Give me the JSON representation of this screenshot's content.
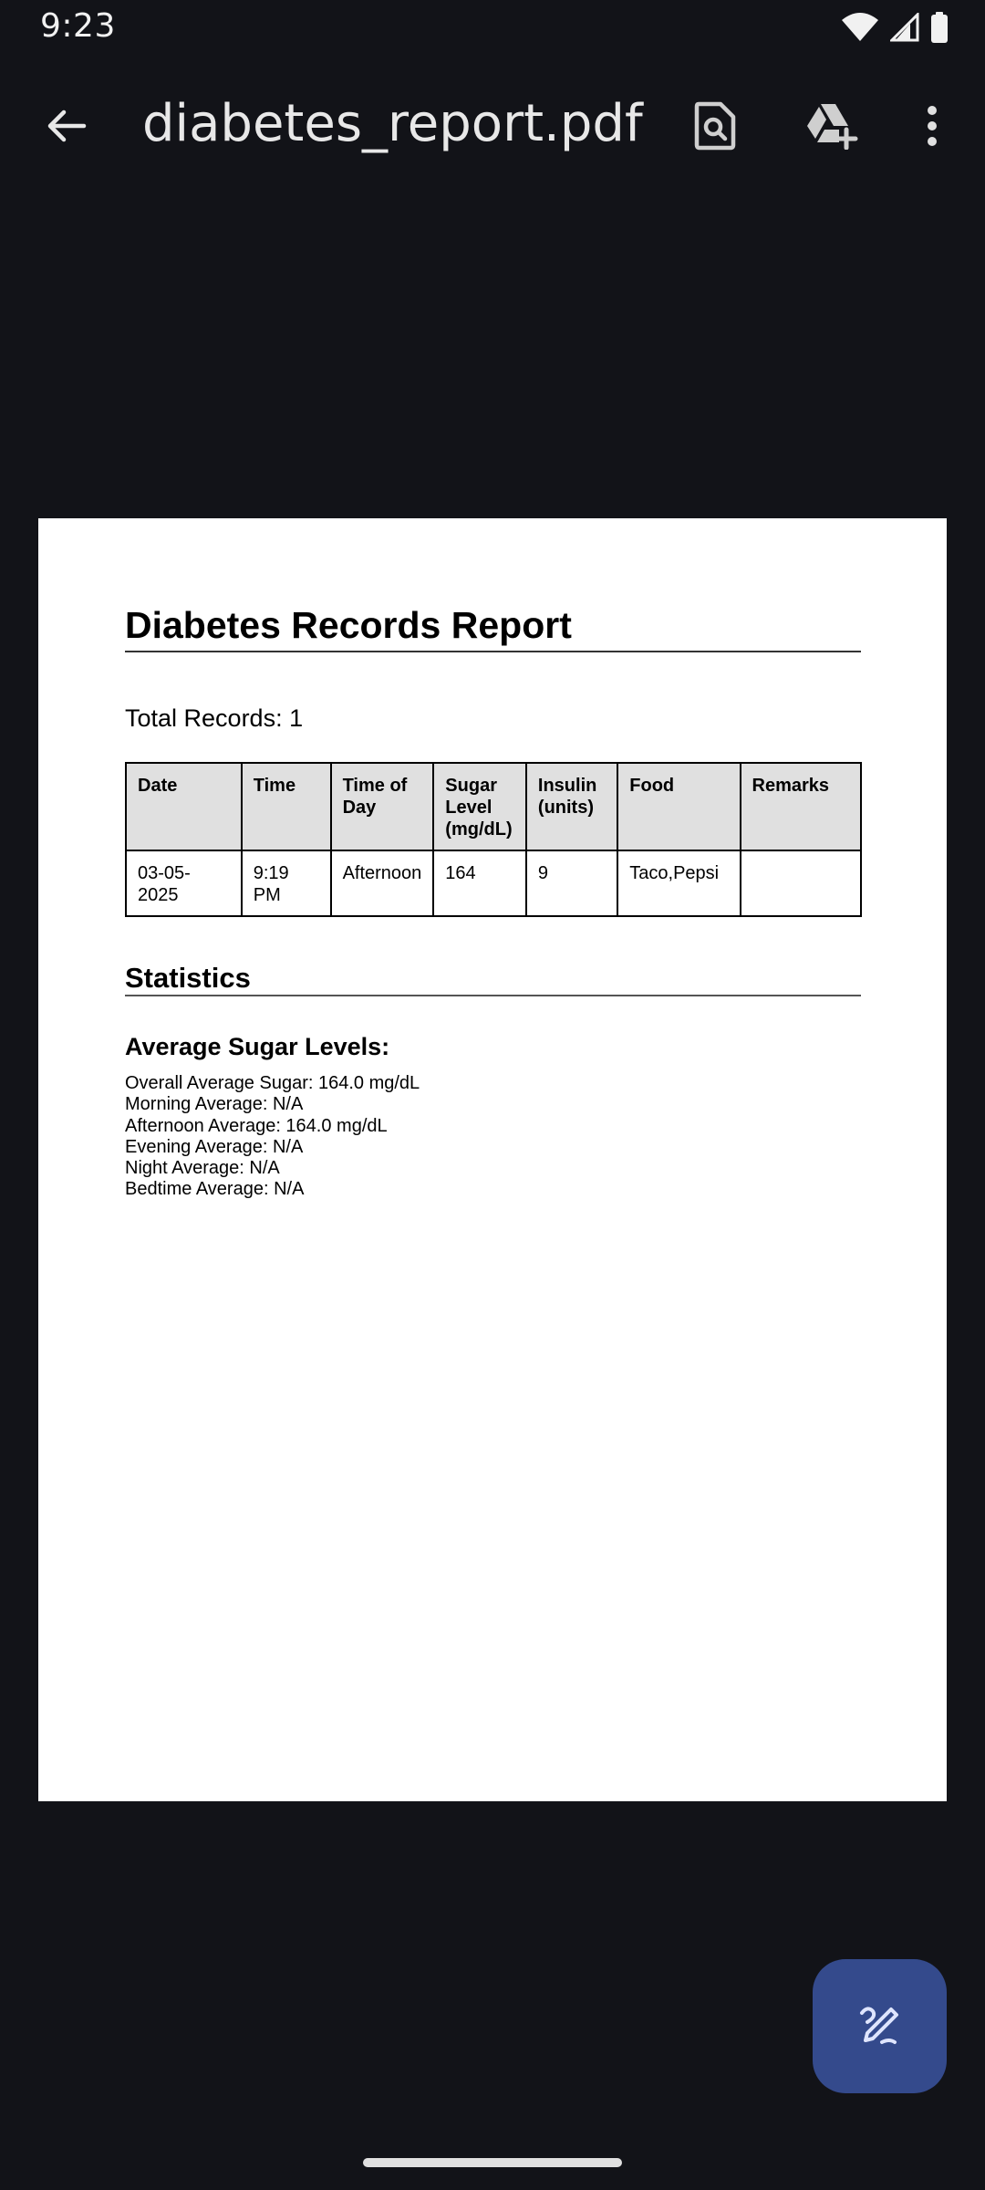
{
  "status_bar": {
    "time": "9:23",
    "icons": [
      "wifi-icon",
      "signal-icon",
      "battery-icon"
    ]
  },
  "app_bar": {
    "title": "diabetes_report.pdf",
    "back_icon": "arrow-back-icon",
    "actions": [
      "find-in-document-icon",
      "add-to-drive-icon",
      "more-vert-icon"
    ]
  },
  "report": {
    "title": "Diabetes Records Report",
    "total_records": "Total Records: 1",
    "table": {
      "headers": {
        "date": "Date",
        "time": "Time",
        "time_of_day": "Time of Day",
        "sugar_level": "Sugar Level (mg/dL)",
        "insulin": "Insulin (units)",
        "food": "Food",
        "remarks": "Remarks"
      },
      "rows": [
        {
          "date": "03-05-2025",
          "time": "9:19 PM",
          "time_of_day": "Afternoon",
          "sugar_level": "164",
          "insulin": "9",
          "food": "Taco,Pepsi",
          "remarks": ""
        }
      ]
    },
    "statistics": {
      "heading": "Statistics",
      "subheading": "Average Sugar Levels:",
      "lines": [
        "Overall Average Sugar: 164.0 mg/dL",
        "Morning Average: N/A",
        "Afternoon Average: 164.0 mg/dL",
        "Evening Average: N/A",
        "Night Average: N/A",
        "Bedtime Average: N/A"
      ]
    }
  },
  "fab": {
    "icon": "annotate-pen-icon"
  },
  "colors": {
    "background": "#121318",
    "fab": "#344a8c",
    "page": "#ffffff",
    "table_header": "#e0e0e0"
  }
}
